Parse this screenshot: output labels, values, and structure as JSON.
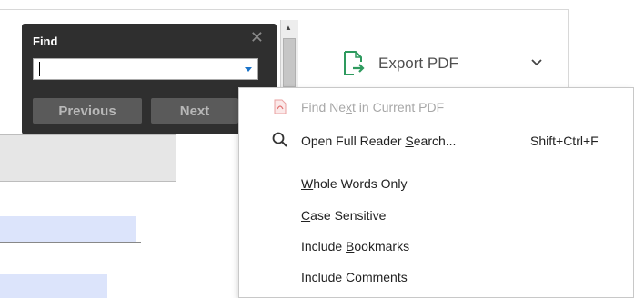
{
  "find_panel": {
    "title": "Find",
    "close_glyph": "✕",
    "search_value": "",
    "previous_label": "Previous",
    "next_label": "Next"
  },
  "toolbar": {
    "export_label": "Export PDF",
    "export_icon": "export-pdf-icon",
    "chevron_icon": "chevron-down-icon"
  },
  "menu": {
    "items": [
      {
        "pre": "Find Ne",
        "ul": "x",
        "post": "t in Current PDF",
        "disabled": true,
        "icon": "pdf-icon"
      },
      {
        "pre": "Open Full Reader ",
        "ul": "S",
        "post": "earch...",
        "shortcut": "Shift+Ctrl+F",
        "icon": "search-icon"
      },
      {
        "pre": "",
        "ul": "W",
        "post": "hole Words Only"
      },
      {
        "pre": "",
        "ul": "C",
        "post": "ase Sensitive"
      },
      {
        "pre": "Include ",
        "ul": "B",
        "post": "ookmarks"
      },
      {
        "pre": "Include Co",
        "ul": "m",
        "post": "ments"
      }
    ]
  },
  "colors": {
    "find_bg": "#2f2f2f",
    "export_icon_green": "#2e9a5e",
    "highlight": "#dce4fb",
    "dropdown_arrow": "#1a73c9"
  }
}
